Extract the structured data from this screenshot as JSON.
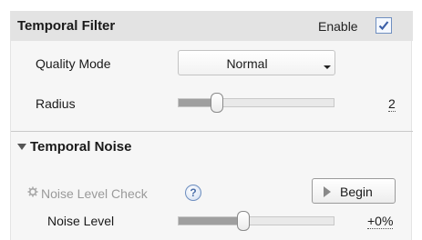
{
  "temporal_filter": {
    "title": "Temporal Filter",
    "enable_label": "Enable",
    "enabled": true,
    "quality_mode": {
      "label": "Quality Mode",
      "value": "Normal"
    },
    "radius": {
      "label": "Radius",
      "value": "2",
      "slider_fraction": 0.25
    }
  },
  "temporal_noise": {
    "title": "Temporal Noise",
    "expanded": true,
    "noise_level_check": {
      "label": "Noise Level Check",
      "help_glyph": "?",
      "button_label": "Begin"
    },
    "noise_level": {
      "label": "Noise Level",
      "value": "+0%",
      "slider_fraction": 0.42
    }
  },
  "icons": {
    "checkbox": "checkmark-icon",
    "dropdown": "chevron-down-icon",
    "section_toggle": "triangle-down-icon",
    "noise_check": "gear-icon",
    "help": "help-icon",
    "begin": "play-icon"
  },
  "colors": {
    "header_bg": "#e3e3e3",
    "panel_bg": "#f6f6f6",
    "disabled_text": "#9a9a9a",
    "accent": "#4a6ea8"
  }
}
